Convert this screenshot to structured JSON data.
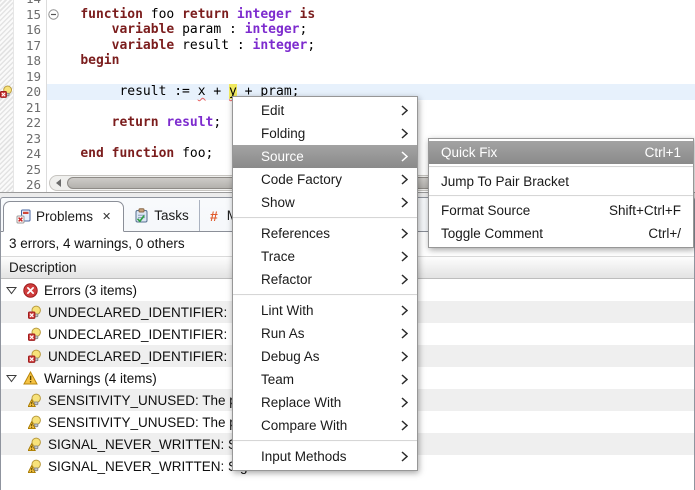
{
  "colors": {
    "keyword": "#7b1d1d",
    "type": "#7d2bce",
    "current_line": "#e7f1fc",
    "occurrence_highlight": "#f0e95f",
    "menu_highlight": "#909090",
    "error": "#cf3d3d",
    "warning": "#f6c344"
  },
  "editor": {
    "annotation": {
      "line": 20,
      "icon": "quickfix-error-annotation-icon"
    },
    "fold": {
      "line": 15,
      "icon": "fold-collapse-icon"
    },
    "lines": [
      {
        "n": 14,
        "tokens": []
      },
      {
        "n": 15,
        "tokens": [
          {
            "c": "p",
            "s": "    "
          },
          {
            "c": "k",
            "s": "function"
          },
          {
            "c": "p",
            "s": " foo "
          },
          {
            "c": "k",
            "s": "return"
          },
          {
            "c": "p",
            "s": " "
          },
          {
            "c": "t",
            "s": "integer"
          },
          {
            "c": "p",
            "s": " "
          },
          {
            "c": "k",
            "s": "is"
          }
        ]
      },
      {
        "n": 16,
        "tokens": [
          {
            "c": "p",
            "s": "        "
          },
          {
            "c": "k",
            "s": "variable"
          },
          {
            "c": "p",
            "s": " param : "
          },
          {
            "c": "t",
            "s": "integer"
          },
          {
            "c": "p",
            "s": ";"
          }
        ]
      },
      {
        "n": 17,
        "tokens": [
          {
            "c": "p",
            "s": "        "
          },
          {
            "c": "k",
            "s": "variable"
          },
          {
            "c": "p",
            "s": " result : "
          },
          {
            "c": "t",
            "s": "integer"
          },
          {
            "c": "p",
            "s": ";"
          }
        ]
      },
      {
        "n": 18,
        "tokens": [
          {
            "c": "p",
            "s": "    "
          },
          {
            "c": "k",
            "s": "begin"
          }
        ]
      },
      {
        "n": 19,
        "tokens": []
      },
      {
        "n": 20,
        "current": true,
        "tokens": [
          {
            "c": "p",
            "s": "         result := "
          },
          {
            "c": "e",
            "s": "x"
          },
          {
            "c": "p",
            "s": " + "
          },
          {
            "c": "o",
            "s": "y"
          },
          {
            "c": "p",
            "s": " + "
          },
          {
            "c": "e",
            "s": "pram"
          },
          {
            "c": "p",
            "s": ";"
          }
        ]
      },
      {
        "n": 21,
        "tokens": []
      },
      {
        "n": 22,
        "tokens": [
          {
            "c": "p",
            "s": "        "
          },
          {
            "c": "k",
            "s": "return"
          },
          {
            "c": "p",
            "s": " "
          },
          {
            "c": "t",
            "s": "result"
          },
          {
            "c": "p",
            "s": ";"
          }
        ]
      },
      {
        "n": 23,
        "tokens": []
      },
      {
        "n": 24,
        "tokens": [
          {
            "c": "p",
            "s": "    "
          },
          {
            "c": "k",
            "s": "end"
          },
          {
            "c": "p",
            "s": " "
          },
          {
            "c": "k",
            "s": "function"
          },
          {
            "c": "p",
            "s": " foo;"
          }
        ]
      },
      {
        "n": 25,
        "tokens": []
      },
      {
        "n": 26,
        "tokens": []
      }
    ]
  },
  "context_menu": {
    "items": [
      {
        "label": "Edit",
        "submenu": true
      },
      {
        "label": "Folding",
        "submenu": true
      },
      {
        "label": "Source",
        "submenu": true,
        "highlighted": true
      },
      {
        "label": "Code Factory",
        "submenu": true
      },
      {
        "label": "Show",
        "submenu": true
      },
      {
        "separator": true
      },
      {
        "label": "References",
        "submenu": true
      },
      {
        "label": "Trace",
        "submenu": true
      },
      {
        "label": "Refactor",
        "submenu": true
      },
      {
        "separator": true
      },
      {
        "label": "Lint With",
        "submenu": true
      },
      {
        "label": "Run As",
        "submenu": true
      },
      {
        "label": "Debug As",
        "submenu": true
      },
      {
        "label": "Team",
        "submenu": true
      },
      {
        "label": "Replace With",
        "submenu": true
      },
      {
        "label": "Compare With",
        "submenu": true
      },
      {
        "separator": true
      },
      {
        "label": "Input Methods",
        "submenu": true
      }
    ]
  },
  "source_submenu": {
    "items": [
      {
        "label": "Quick Fix",
        "shortcut": "Ctrl+1",
        "highlighted": true
      },
      {
        "separator": true
      },
      {
        "label": "Jump To Pair Bracket",
        "shortcut": ""
      },
      {
        "separator": true
      },
      {
        "label": "Format Source",
        "shortcut": "Shift+Ctrl+F"
      },
      {
        "label": "Toggle Comment",
        "shortcut": "Ctrl+/"
      }
    ]
  },
  "problems_view": {
    "tabs": [
      {
        "label": "Problems",
        "icon": "problems-icon",
        "active": true,
        "closable": true,
        "close_glyph": "✕"
      },
      {
        "label": "Tasks",
        "icon": "tasks-icon",
        "active": false
      },
      {
        "label": "Ma",
        "icon": "hash-icon",
        "active": false
      }
    ],
    "summary": "3 errors, 4 warnings, 0 others",
    "columns": [
      "Description"
    ],
    "rows": [
      {
        "type": "group",
        "icon": "error-circle-icon",
        "arrow": "tree-expanded-icon",
        "text": "Errors (3 items)"
      },
      {
        "type": "item",
        "icon": "quickfix-error-icon",
        "text": "UNDECLARED_IDENTIFIER: Identifier 'pram' is not declared"
      },
      {
        "type": "item",
        "icon": "quickfix-error-icon",
        "text": "UNDECLARED_IDENTIFIER: Identifier 'x' is not declared"
      },
      {
        "type": "item",
        "icon": "quickfix-error-icon",
        "text": "UNDECLARED_IDENTIFIER: Identifier 'y' is not declared"
      },
      {
        "type": "group",
        "icon": "warning-triangle-icon",
        "arrow": "tree-expanded-icon",
        "text": "Warnings (4 items)"
      },
      {
        "type": "item",
        "icon": "quickfix-warning-icon",
        "text": "SENSITIVITY_UNUSED: The process is not sensitive to 'clk'"
      },
      {
        "type": "item",
        "icon": "quickfix-warning-icon",
        "text": "SENSITIVITY_UNUSED: The process is not sensitive to 'rst'"
      },
      {
        "type": "item",
        "icon": "quickfix-warning-icon",
        "text": "SIGNAL_NEVER_WRITTEN: Signal 'clk' is never written"
      },
      {
        "type": "item",
        "icon": "quickfix-warning-icon",
        "text": "SIGNAL_NEVER_WRITTEN: Signal 'rst' is never written"
      }
    ]
  }
}
